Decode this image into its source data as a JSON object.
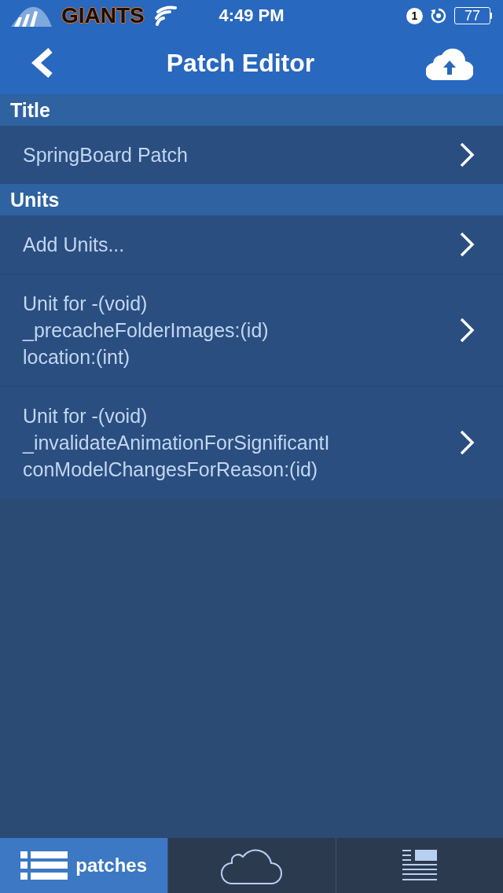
{
  "status_bar": {
    "carrier": "GIANTS",
    "time": "4:49 PM",
    "notification_count": "1",
    "battery": "77"
  },
  "nav_bar": {
    "title": "Patch Editor"
  },
  "sections": [
    {
      "header": "Title",
      "rows": [
        {
          "text": "SpringBoard Patch"
        }
      ]
    },
    {
      "header": "Units",
      "rows": [
        {
          "text": "Add Units..."
        },
        {
          "text": "Unit for -(void)\n_precacheFolderImages:(id)\nlocation:(int)"
        },
        {
          "text": "Unit for -(void)\n_invalidateAnimationForSignificantI\nconModelChangesForReason:(id)"
        }
      ]
    }
  ],
  "tab_bar": {
    "tabs": [
      {
        "kind": "list",
        "label": "patches",
        "selected": true
      },
      {
        "kind": "cloud",
        "selected": false
      },
      {
        "kind": "article",
        "selected": false
      }
    ]
  }
}
